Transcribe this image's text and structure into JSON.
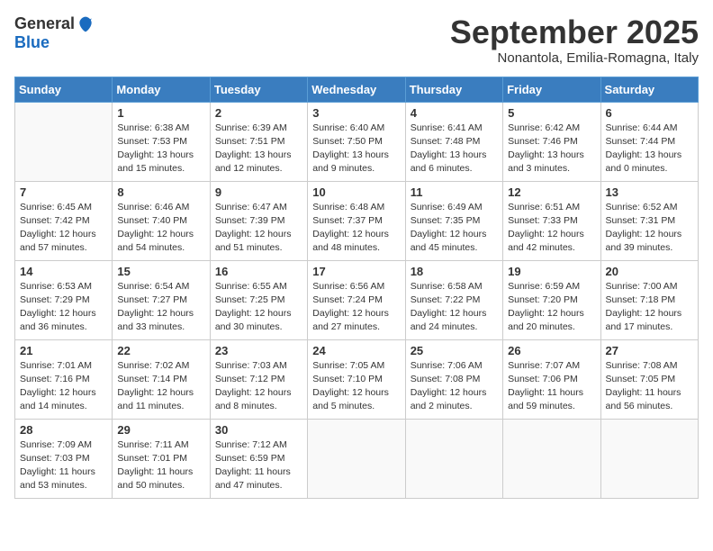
{
  "logo": {
    "general": "General",
    "blue": "Blue"
  },
  "title": {
    "month": "September 2025",
    "location": "Nonantola, Emilia-Romagna, Italy"
  },
  "days": [
    "Sunday",
    "Monday",
    "Tuesday",
    "Wednesday",
    "Thursday",
    "Friday",
    "Saturday"
  ],
  "weeks": [
    [
      {
        "day": "",
        "info": ""
      },
      {
        "day": "1",
        "info": "Sunrise: 6:38 AM\nSunset: 7:53 PM\nDaylight: 13 hours\nand 15 minutes."
      },
      {
        "day": "2",
        "info": "Sunrise: 6:39 AM\nSunset: 7:51 PM\nDaylight: 13 hours\nand 12 minutes."
      },
      {
        "day": "3",
        "info": "Sunrise: 6:40 AM\nSunset: 7:50 PM\nDaylight: 13 hours\nand 9 minutes."
      },
      {
        "day": "4",
        "info": "Sunrise: 6:41 AM\nSunset: 7:48 PM\nDaylight: 13 hours\nand 6 minutes."
      },
      {
        "day": "5",
        "info": "Sunrise: 6:42 AM\nSunset: 7:46 PM\nDaylight: 13 hours\nand 3 minutes."
      },
      {
        "day": "6",
        "info": "Sunrise: 6:44 AM\nSunset: 7:44 PM\nDaylight: 13 hours\nand 0 minutes."
      }
    ],
    [
      {
        "day": "7",
        "info": "Sunrise: 6:45 AM\nSunset: 7:42 PM\nDaylight: 12 hours\nand 57 minutes."
      },
      {
        "day": "8",
        "info": "Sunrise: 6:46 AM\nSunset: 7:40 PM\nDaylight: 12 hours\nand 54 minutes."
      },
      {
        "day": "9",
        "info": "Sunrise: 6:47 AM\nSunset: 7:39 PM\nDaylight: 12 hours\nand 51 minutes."
      },
      {
        "day": "10",
        "info": "Sunrise: 6:48 AM\nSunset: 7:37 PM\nDaylight: 12 hours\nand 48 minutes."
      },
      {
        "day": "11",
        "info": "Sunrise: 6:49 AM\nSunset: 7:35 PM\nDaylight: 12 hours\nand 45 minutes."
      },
      {
        "day": "12",
        "info": "Sunrise: 6:51 AM\nSunset: 7:33 PM\nDaylight: 12 hours\nand 42 minutes."
      },
      {
        "day": "13",
        "info": "Sunrise: 6:52 AM\nSunset: 7:31 PM\nDaylight: 12 hours\nand 39 minutes."
      }
    ],
    [
      {
        "day": "14",
        "info": "Sunrise: 6:53 AM\nSunset: 7:29 PM\nDaylight: 12 hours\nand 36 minutes."
      },
      {
        "day": "15",
        "info": "Sunrise: 6:54 AM\nSunset: 7:27 PM\nDaylight: 12 hours\nand 33 minutes."
      },
      {
        "day": "16",
        "info": "Sunrise: 6:55 AM\nSunset: 7:25 PM\nDaylight: 12 hours\nand 30 minutes."
      },
      {
        "day": "17",
        "info": "Sunrise: 6:56 AM\nSunset: 7:24 PM\nDaylight: 12 hours\nand 27 minutes."
      },
      {
        "day": "18",
        "info": "Sunrise: 6:58 AM\nSunset: 7:22 PM\nDaylight: 12 hours\nand 24 minutes."
      },
      {
        "day": "19",
        "info": "Sunrise: 6:59 AM\nSunset: 7:20 PM\nDaylight: 12 hours\nand 20 minutes."
      },
      {
        "day": "20",
        "info": "Sunrise: 7:00 AM\nSunset: 7:18 PM\nDaylight: 12 hours\nand 17 minutes."
      }
    ],
    [
      {
        "day": "21",
        "info": "Sunrise: 7:01 AM\nSunset: 7:16 PM\nDaylight: 12 hours\nand 14 minutes."
      },
      {
        "day": "22",
        "info": "Sunrise: 7:02 AM\nSunset: 7:14 PM\nDaylight: 12 hours\nand 11 minutes."
      },
      {
        "day": "23",
        "info": "Sunrise: 7:03 AM\nSunset: 7:12 PM\nDaylight: 12 hours\nand 8 minutes."
      },
      {
        "day": "24",
        "info": "Sunrise: 7:05 AM\nSunset: 7:10 PM\nDaylight: 12 hours\nand 5 minutes."
      },
      {
        "day": "25",
        "info": "Sunrise: 7:06 AM\nSunset: 7:08 PM\nDaylight: 12 hours\nand 2 minutes."
      },
      {
        "day": "26",
        "info": "Sunrise: 7:07 AM\nSunset: 7:06 PM\nDaylight: 11 hours\nand 59 minutes."
      },
      {
        "day": "27",
        "info": "Sunrise: 7:08 AM\nSunset: 7:05 PM\nDaylight: 11 hours\nand 56 minutes."
      }
    ],
    [
      {
        "day": "28",
        "info": "Sunrise: 7:09 AM\nSunset: 7:03 PM\nDaylight: 11 hours\nand 53 minutes."
      },
      {
        "day": "29",
        "info": "Sunrise: 7:11 AM\nSunset: 7:01 PM\nDaylight: 11 hours\nand 50 minutes."
      },
      {
        "day": "30",
        "info": "Sunrise: 7:12 AM\nSunset: 6:59 PM\nDaylight: 11 hours\nand 47 minutes."
      },
      {
        "day": "",
        "info": ""
      },
      {
        "day": "",
        "info": ""
      },
      {
        "day": "",
        "info": ""
      },
      {
        "day": "",
        "info": ""
      }
    ]
  ]
}
